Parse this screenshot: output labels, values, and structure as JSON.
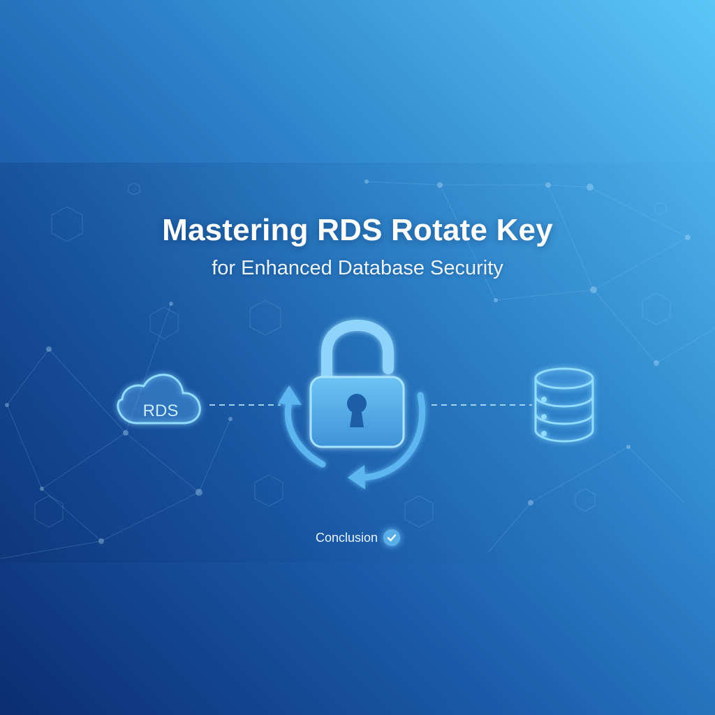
{
  "title": "Mastering RDS Rotate Key",
  "subtitle": "for Enhanced Database Security",
  "diagram": {
    "cloud_label": "RDS",
    "icons": [
      "cloud-icon",
      "padlock-icon",
      "rotate-arrows-icon",
      "database-icon"
    ]
  },
  "conclusion": {
    "label": "Conclusion",
    "icon": "check-icon"
  },
  "colors": {
    "background_dark": "#0b2d72",
    "background_light": "#5cc6f7",
    "icon_stroke": "#8fdcff",
    "icon_fill": "#4aa3e4",
    "text": "#ffffff"
  }
}
